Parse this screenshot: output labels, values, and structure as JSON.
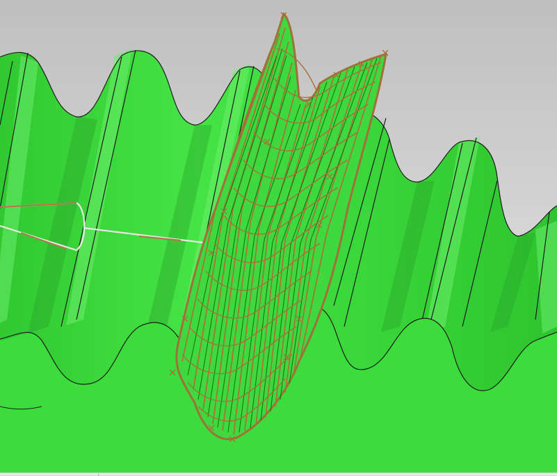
{
  "window": {
    "title": ""
  },
  "viewport": {
    "background_top": "#c3c3c3",
    "background_bottom": "#ececec",
    "surface_color": "#3cd93c",
    "surface_dark": "#2fbf2f",
    "surface_light": "#7cf07c",
    "edge_color": "#1b1b1b",
    "tool_path_color": "#a0703a",
    "tool_path_inner": "#0a7a0a",
    "cutter_outline_color": "#f2f2f2"
  },
  "statusbar": {
    "text": ""
  }
}
